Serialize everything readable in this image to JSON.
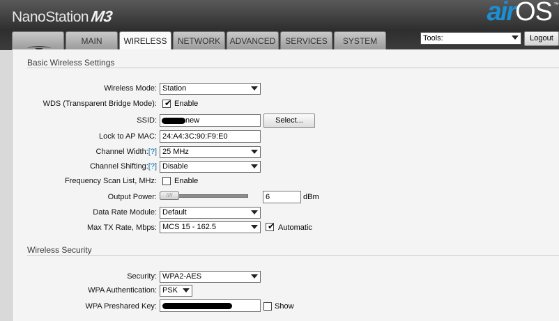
{
  "header": {
    "product_name": "NanoStation",
    "model": "M3",
    "brand_air": "air",
    "brand_os": "OS",
    "tm": "™",
    "tools_label": "Tools:",
    "logout_label": "Logout"
  },
  "tabs": [
    {
      "label": "",
      "icon": "ubiquiti-logo-icon"
    },
    {
      "label": "MAIN"
    },
    {
      "label": "WIRELESS",
      "active": true
    },
    {
      "label": "NETWORK"
    },
    {
      "label": "ADVANCED"
    },
    {
      "label": "SERVICES"
    },
    {
      "label": "SYSTEM"
    }
  ],
  "basic": {
    "title": "Basic Wireless Settings",
    "wireless_mode_label": "Wireless Mode:",
    "wireless_mode_value": "Station",
    "wds_label": "WDS (Transparent Bridge Mode):",
    "wds_enable_label": "Enable",
    "wds_checked": true,
    "ssid_label": "SSID:",
    "ssid_value_visible": "new",
    "select_button": "Select...",
    "lock_mac_label": "Lock to AP MAC:",
    "lock_mac_value": "24:A4:3C:90:F9:E0",
    "channel_width_label": "Channel Width:",
    "channel_width_value": "25 MHz",
    "channel_shifting_label": "Channel Shifting:",
    "channel_shifting_value": "Disable",
    "help": "[?]",
    "freq_scan_label": "Frequency Scan List, MHz:",
    "freq_scan_enable_label": "Enable",
    "freq_scan_checked": false,
    "output_power_label": "Output Power:",
    "output_power_value": "6",
    "output_power_unit": "dBm",
    "data_rate_label": "Data Rate Module:",
    "data_rate_value": "Default",
    "max_tx_label": "Max TX Rate, Mbps:",
    "max_tx_value": "MCS 15 - 162.5",
    "automatic_label": "Automatic",
    "automatic_checked": true
  },
  "security": {
    "title": "Wireless Security",
    "security_label": "Security:",
    "security_value": "WPA2-AES",
    "wpa_auth_label": "WPA Authentication:",
    "wpa_auth_value": "PSK",
    "psk_label": "WPA Preshared Key:",
    "show_label": "Show",
    "show_checked": false
  }
}
